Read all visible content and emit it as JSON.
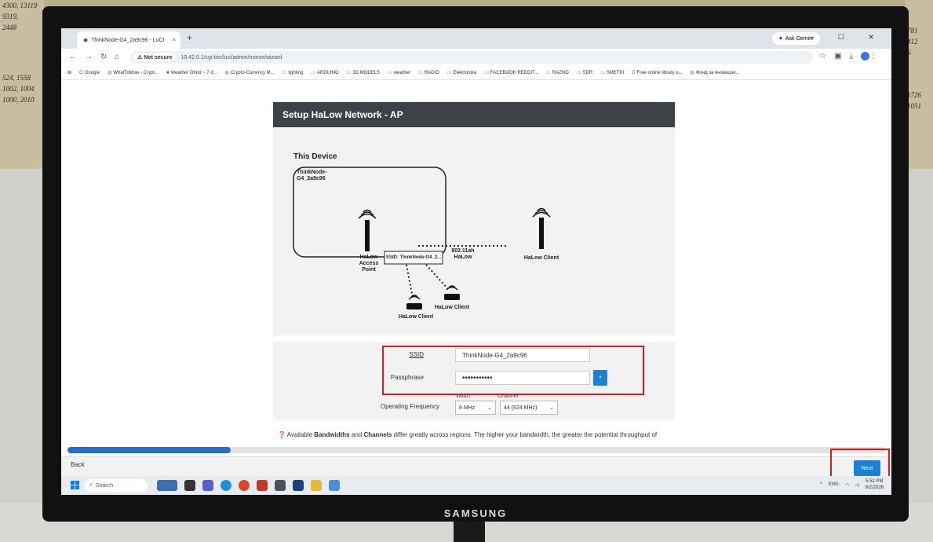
{
  "environment": {
    "monitor_brand": "SAMSUNG",
    "shelf_left": [
      "4300, 13119",
      "9319,",
      "2448",
      "524, 1558",
      "1002, 1004",
      "1000, 2010"
    ],
    "shelf_right": [
      "781",
      "412",
      "6",
      "1726",
      "1051"
    ]
  },
  "browser": {
    "tab_title": "ThinkNode-G4_2a9c96 - LuCI",
    "tab_close": "×",
    "new_tab": "+",
    "gemini_label": "Ask Gemini",
    "window_controls": "– ☐ ✕",
    "security_chip": "Not secure",
    "url": "10.42.0.1/cgi-bin/luci/admin/morse/wizard",
    "bookmarks": [
      "Google",
      "WhatToMow - Crypt...",
      "Weather Ohrid ~ 7 d...",
      "Crypto-Currency M...",
      "lighting",
      "ARDUINO",
      "3D MODELS",
      "weather",
      "RADIO",
      "Elektronika",
      "FACEBOOK REDDIT...",
      "RAZNO",
      "SDR",
      "SMETKI",
      "Free online library o...",
      "Фонд за иновации..."
    ]
  },
  "page": {
    "title": "Setup HaLow Network - AP",
    "diagram": {
      "this_device": "This Device",
      "device_name": "ThinkNode-G4_2a9c96",
      "access_point": "HaLow Access Point",
      "ssid_box": "SSID: ThinkNode-G4_2...",
      "link_label": "802.11ah HaLow",
      "client_right": "HaLow Client",
      "client_bottom_1": "HaLow Client",
      "client_bottom_2": "HaLow Client"
    },
    "form": {
      "ssid_label": "SSID",
      "ssid_value": "ThinkNode-G4_2a9c96",
      "passphrase_label": "Passphrase",
      "passphrase_value": "•••••••••••",
      "reveal_glyph": "*",
      "freq_label": "Operating Frequency",
      "width_label": "Width",
      "width_value": "8 MHz",
      "channel_label": "Channel",
      "channel_value": "44 (924 MHz)"
    },
    "note_strong1": "Bandwidths",
    "note_strong2": "Channels",
    "note_pre": "Available ",
    "note_mid": " and ",
    "note_post": " differ greatly across regions. The higher your bandwidth, the greater the potential throughput of",
    "progress": 0.2,
    "back_label": "Back",
    "next_label": "Next"
  },
  "taskbar": {
    "search_placeholder": "Search",
    "lang": "ENG",
    "time": "5:52 PM",
    "date": "8/2/2026"
  },
  "colors": {
    "accent": "#1c7fd4",
    "header": "#3d4249",
    "highlight": "#d31f1f",
    "progress": "#2a6cc4"
  }
}
